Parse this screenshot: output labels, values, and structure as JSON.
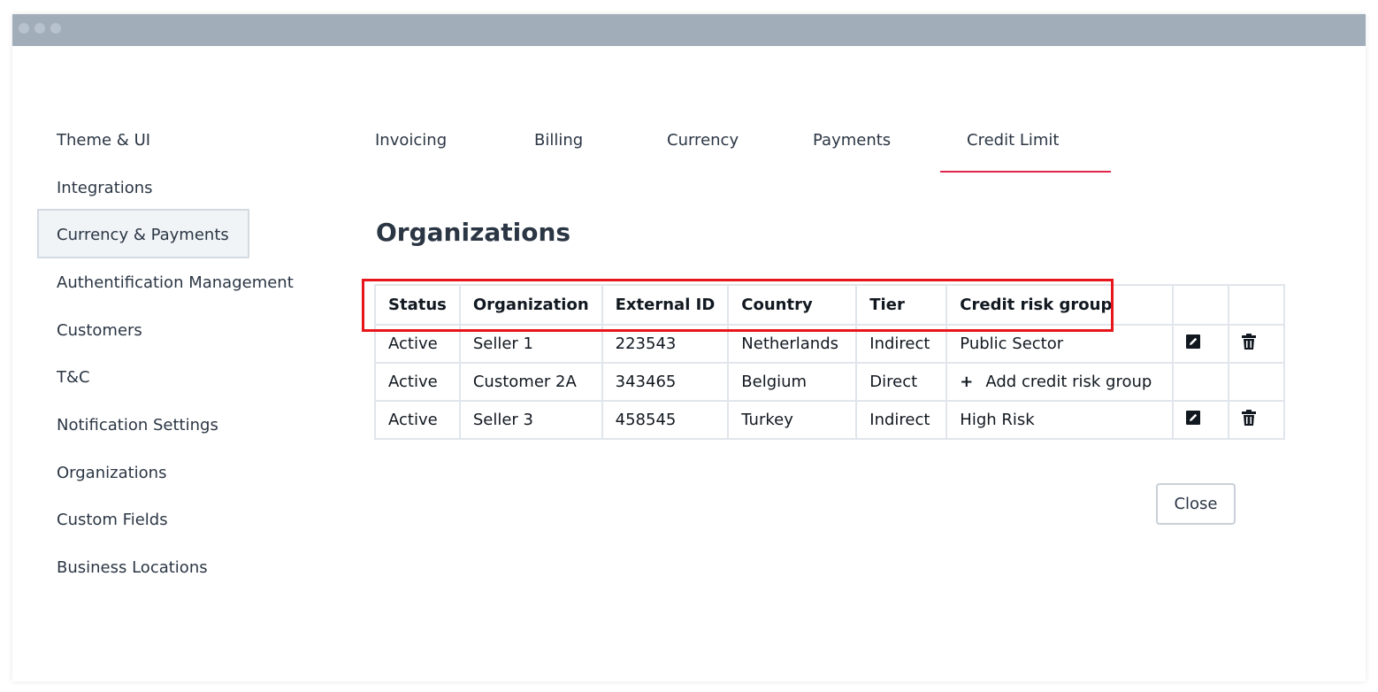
{
  "sidebar": {
    "items": [
      {
        "label": "Theme & UI"
      },
      {
        "label": "Integrations"
      },
      {
        "label": "Currency & Payments",
        "active": true
      },
      {
        "label": "Authentification Management"
      },
      {
        "label": "Customers"
      },
      {
        "label": "T&C"
      },
      {
        "label": "Notification Settings"
      },
      {
        "label": "Organizations"
      },
      {
        "label": "Custom Fields"
      },
      {
        "label": "Business Locations"
      }
    ]
  },
  "tabs": [
    {
      "label": "Invoicing"
    },
    {
      "label": "Billing"
    },
    {
      "label": "Currency"
    },
    {
      "label": "Payments"
    },
    {
      "label": "Credit Limit",
      "active": true
    }
  ],
  "main": {
    "title": "Organizations",
    "table": {
      "headers": [
        "Status",
        "Organization",
        "External ID",
        "Country",
        "Tier",
        "Credit risk group"
      ],
      "rows": [
        {
          "status": "Active",
          "organization": "Seller 1",
          "external_id": "223543",
          "country": "Netherlands",
          "tier": "Indirect",
          "credit_risk_group": "Public Sector",
          "has_actions": true
        },
        {
          "status": "Active",
          "organization": "Customer 2A",
          "external_id": "343465",
          "country": "Belgium",
          "tier": "Direct",
          "credit_risk_group": "",
          "add_label": "Add credit risk group",
          "has_actions": false
        },
        {
          "status": "Active",
          "organization": "Seller 3",
          "external_id": "458545",
          "country": "Turkey",
          "tier": "Indirect",
          "credit_risk_group": "High Risk",
          "has_actions": true
        }
      ]
    },
    "close_label": "Close"
  },
  "icons": {
    "edit": "edit-icon",
    "delete": "trash-icon",
    "add": "plus-icon"
  },
  "colors": {
    "accent": "#e0264a",
    "highlight": "#e8161b",
    "titlebar": "#a1adb9"
  }
}
